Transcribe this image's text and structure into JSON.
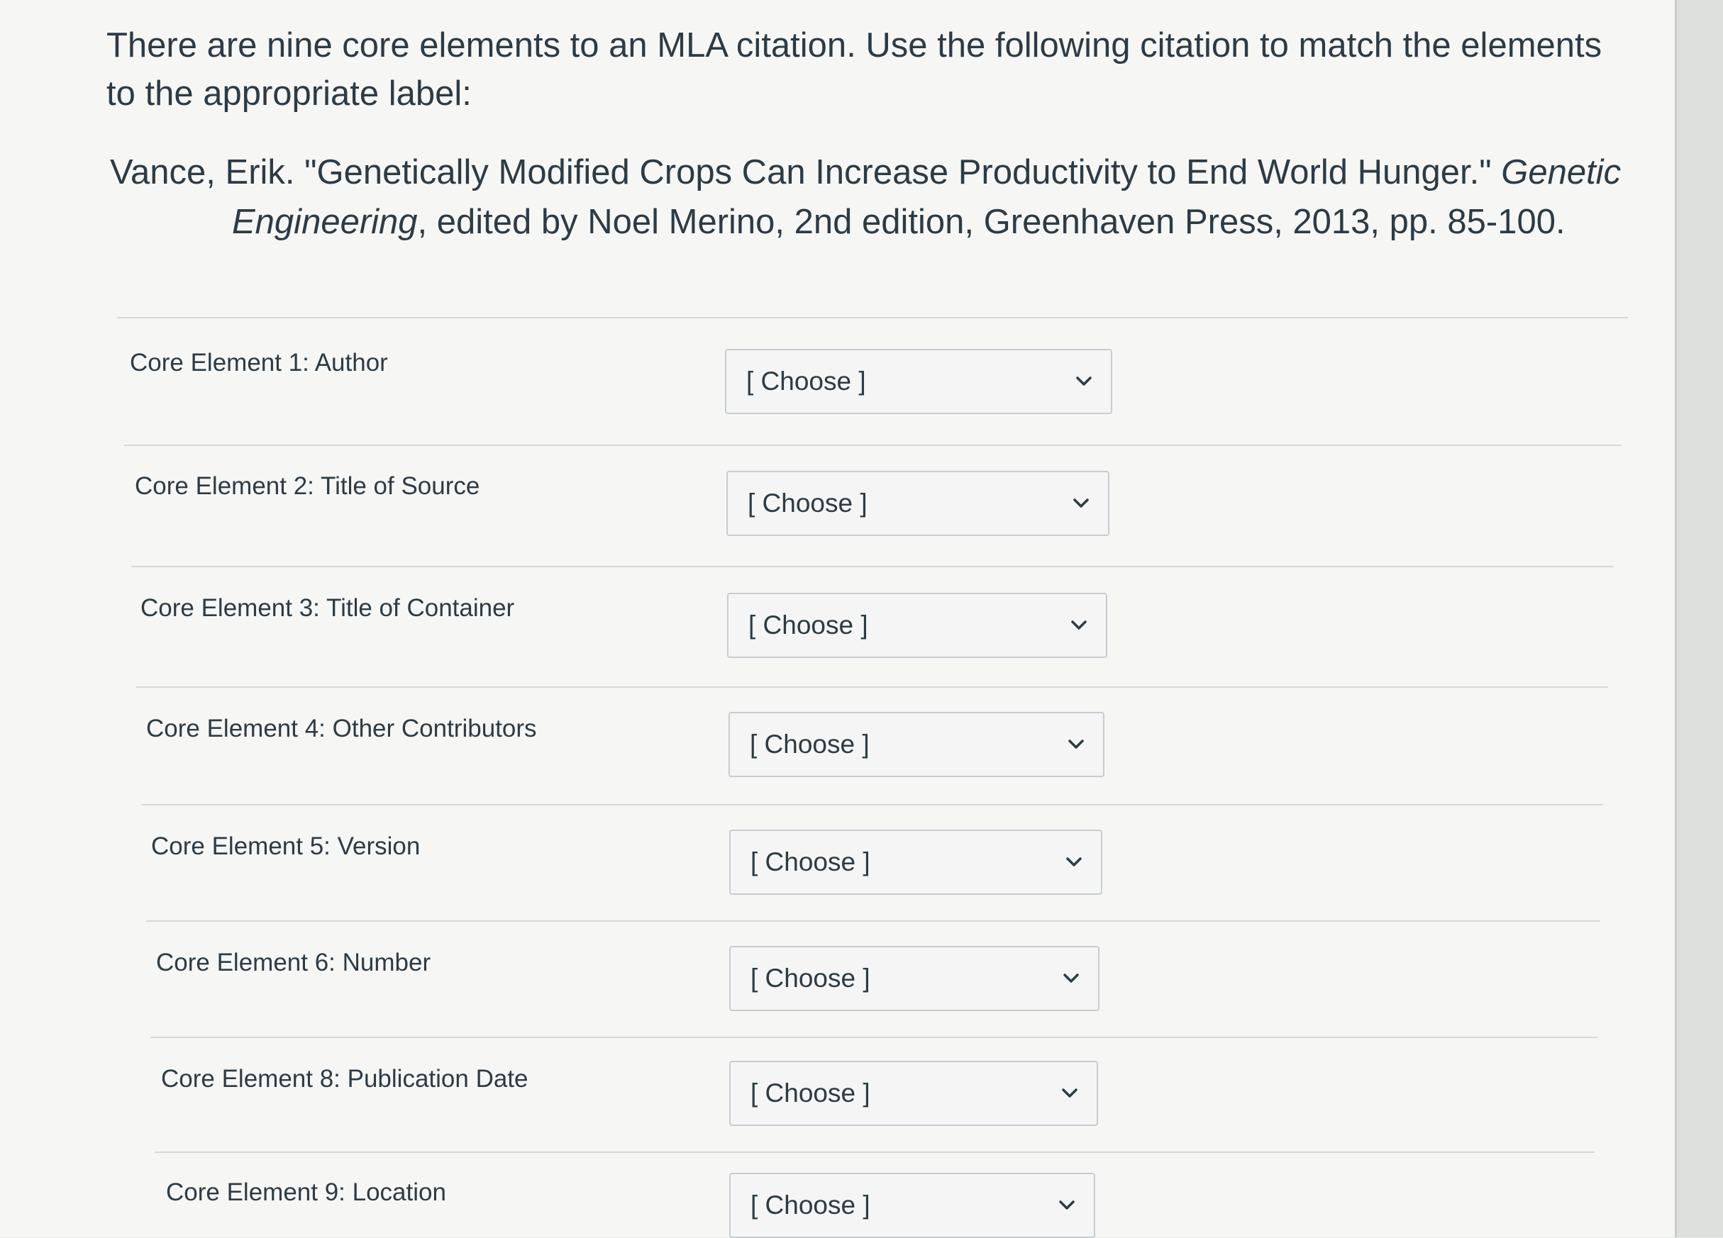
{
  "question": {
    "text": "There are nine core elements to an MLA citation. Use the following citation to match the elements to the appropriate label:",
    "citation_plain_1": "Vance, Erik. \"Genetically Modified Crops Can Increase Productivity to End World Hunger.\" ",
    "citation_italic": "Genetic Engineering",
    "citation_plain_2": ", edited by Noel Merino, 2nd edition, Greenhaven Press, 2013, pp. 85-100."
  },
  "rows": [
    {
      "label": "Core Element 1: Author",
      "selected": "[ Choose ]"
    },
    {
      "label": "Core Element 2: Title of Source",
      "selected": "[ Choose ]"
    },
    {
      "label": "Core Element 3: Title of Container",
      "selected": "[ Choose ]"
    },
    {
      "label": "Core Element 4: Other Contributors",
      "selected": "[ Choose ]"
    },
    {
      "label": "Core Element 5: Version",
      "selected": "[ Choose ]"
    },
    {
      "label": "Core Element 6: Number",
      "selected": "[ Choose ]"
    },
    {
      "label": "Core Element 8: Publication Date",
      "selected": "[ Choose ]"
    },
    {
      "label": "Core Element 9: Location",
      "selected": "[ Choose ]"
    }
  ],
  "icons": {
    "dropdown": "chevron-down-icon"
  },
  "colors": {
    "text": "#2d3b45",
    "select_border": "#c7cdd1",
    "divider": "#d6d9d6"
  }
}
